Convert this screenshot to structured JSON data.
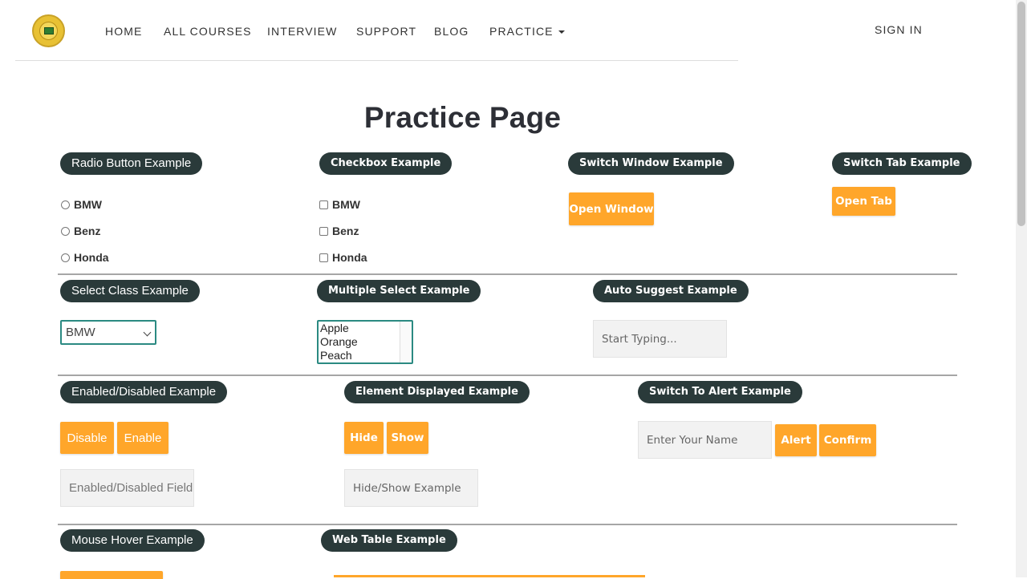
{
  "nav": {
    "items": [
      "HOME",
      "ALL COURSES",
      "INTERVIEW",
      "SUPPORT",
      "BLOG",
      "PRACTICE"
    ],
    "signin": "SIGN IN"
  },
  "page_title": "Practice Page",
  "radio": {
    "legend": "Radio Button Example",
    "options": [
      "BMW",
      "Benz",
      "Honda"
    ]
  },
  "checkbox": {
    "legend": "Checkbox Example",
    "options": [
      "BMW",
      "Benz",
      "Honda"
    ]
  },
  "switch_window": {
    "legend": "Switch Window Example",
    "button": "Open Window"
  },
  "switch_tab": {
    "legend": "Switch Tab Example",
    "button": "Open Tab"
  },
  "select_class": {
    "legend": "Select Class Example",
    "selected": "BMW"
  },
  "multiple_select": {
    "legend": "Multiple Select Example",
    "options": [
      "Apple",
      "Orange",
      "Peach"
    ]
  },
  "auto_suggest": {
    "legend": "Auto Suggest Example",
    "placeholder": "Start Typing..."
  },
  "enabled_disabled": {
    "legend": "Enabled/Disabled Example",
    "disable_button": "Disable",
    "enable_button": "Enable",
    "placeholder": "Enabled/Disabled Field"
  },
  "element_displayed": {
    "legend": "Element Displayed Example",
    "hide_button": "Hide",
    "show_button": "Show",
    "placeholder": "Hide/Show Example"
  },
  "alert": {
    "legend": "Switch To Alert Example",
    "placeholder": "Enter Your Name",
    "alert_button": "Alert",
    "confirm_button": "Confirm"
  },
  "mouse_hover": {
    "legend": "Mouse Hover Example"
  },
  "web_table": {
    "legend": "Web Table Example"
  },
  "colors": {
    "accent": "#ffa62a",
    "legend_bg": "#2a3a3a",
    "select_border": "#2b8a82"
  }
}
